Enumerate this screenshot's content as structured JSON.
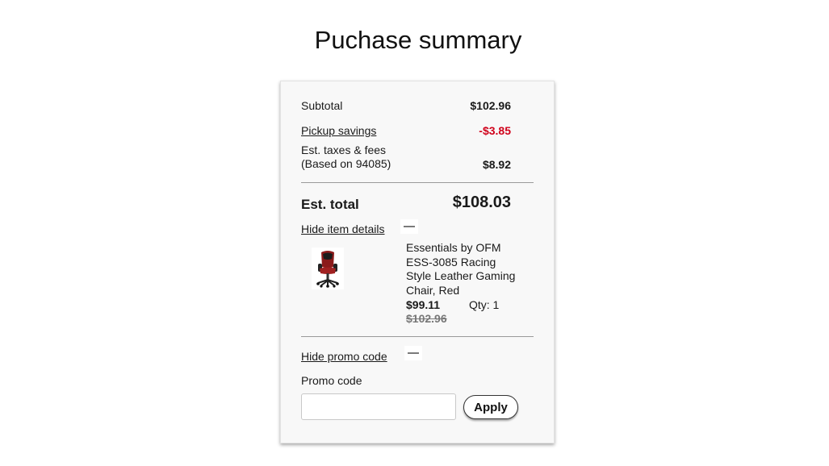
{
  "page": {
    "title": "Puchase summary"
  },
  "summary": {
    "subtotal_label": "Subtotal",
    "subtotal_value": "$102.96",
    "savings_label": "Pickup savings",
    "savings_value": "-$3.85",
    "taxes_label_line1": "Est. taxes & fees",
    "taxes_label_line2": "(Based on 94085)",
    "taxes_value": "$8.92",
    "total_label": "Est. total",
    "total_value": "$108.03"
  },
  "item_details": {
    "toggle_label": "Hide item details",
    "product_name": "Essentials by OFM ESS-3085 Racing Style Leather Gaming Chair, Red",
    "price": "$99.11",
    "qty": "Qty: 1",
    "original_price": "$102.96",
    "thumbnail": "gaming-chair-image"
  },
  "promo": {
    "toggle_label": "Hide promo code",
    "field_label": "Promo code",
    "input_value": "",
    "apply_label": "Apply"
  },
  "colors": {
    "savings": "#d0021b",
    "divider": "#9a9a9a",
    "card_background": "#f8f8f8"
  }
}
